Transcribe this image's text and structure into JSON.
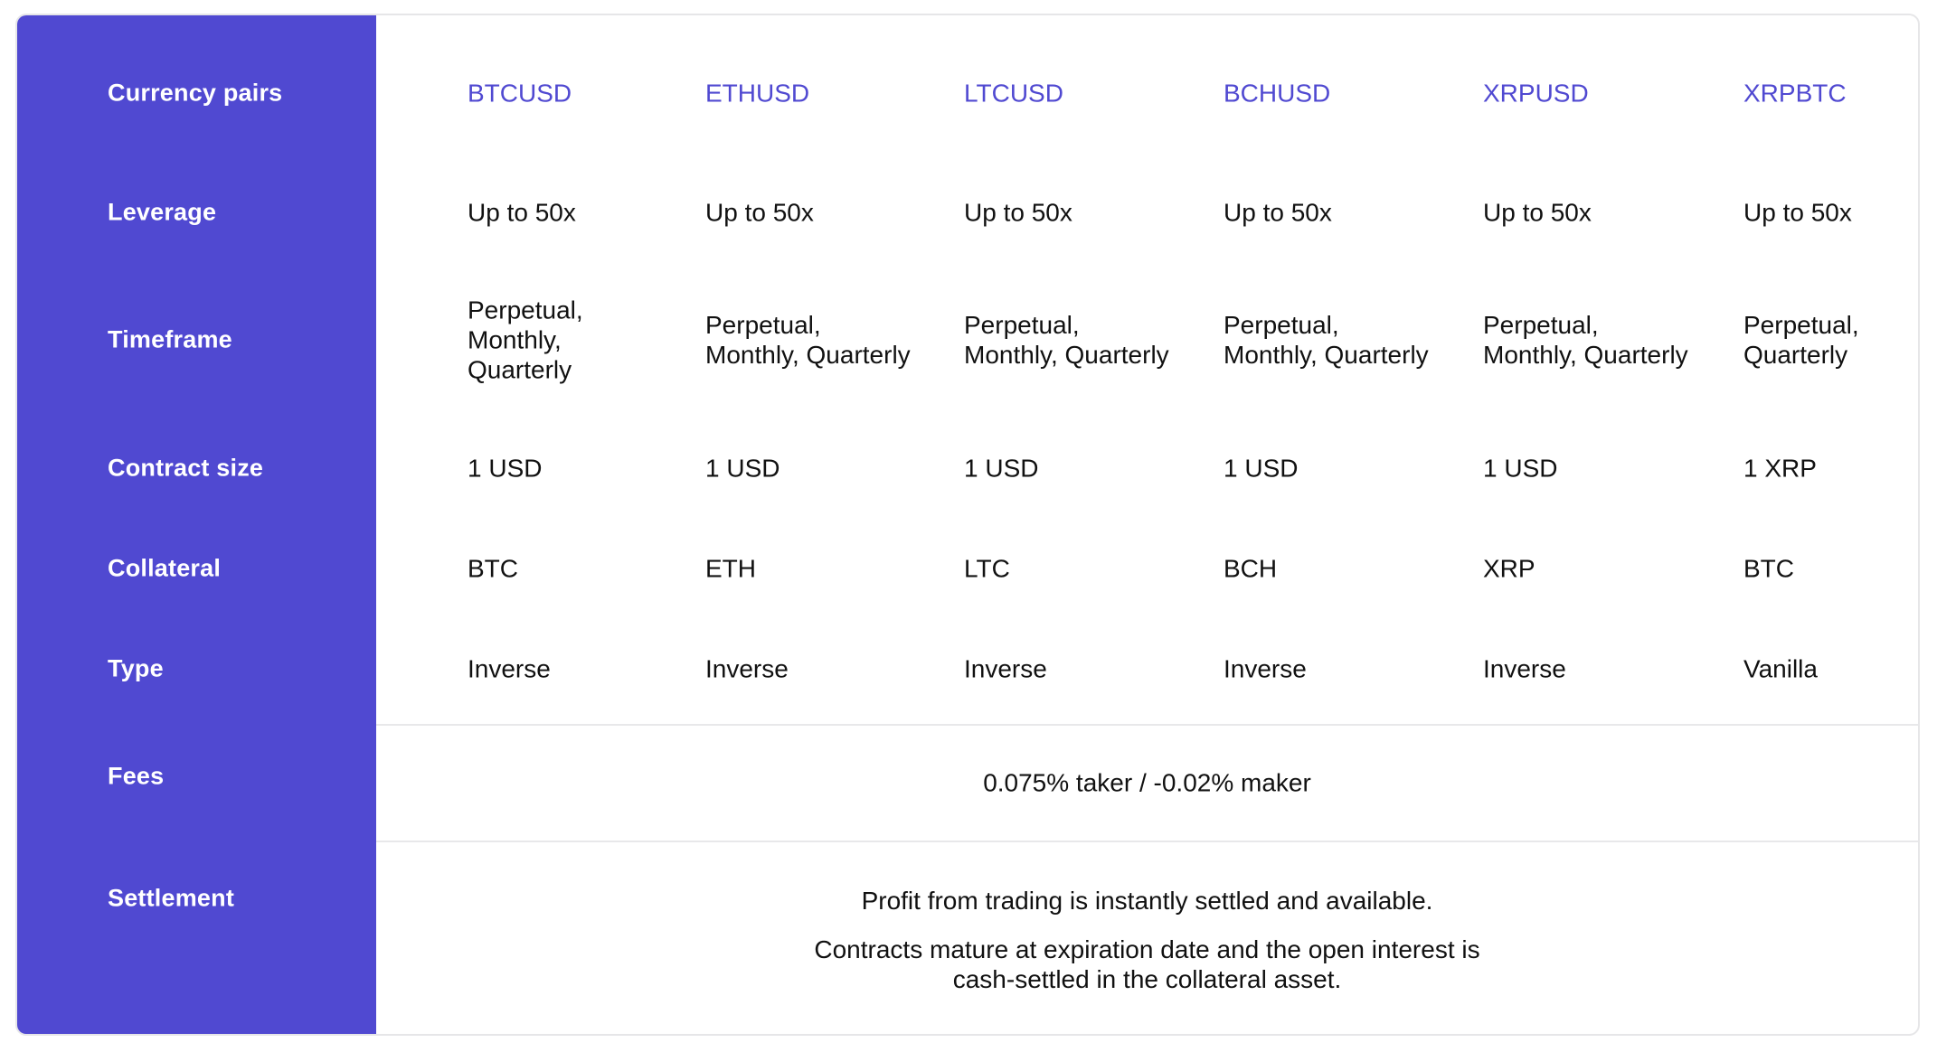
{
  "colors": {
    "accent": "#5049d1",
    "text": "#111111",
    "divider": "#e8e8ea"
  },
  "row_labels": {
    "currency_pairs": "Currency pairs",
    "leverage": "Leverage",
    "timeframe": "Timeframe",
    "contract_size": "Contract size",
    "collateral": "Collateral",
    "type": "Type",
    "fees": "Fees",
    "settlement": "Settlement"
  },
  "columns": [
    {
      "pair": "BTCUSD",
      "leverage": "Up to 50x",
      "timeframe": [
        "Perpetual,",
        "Monthly,",
        "Quarterly"
      ],
      "contract_size": "1 USD",
      "collateral": "BTC",
      "type": "Inverse"
    },
    {
      "pair": "ETHUSD",
      "leverage": "Up to 50x",
      "timeframe": [
        "Perpetual,",
        "Monthly, Quarterly"
      ],
      "contract_size": "1 USD",
      "collateral": "ETH",
      "type": "Inverse"
    },
    {
      "pair": "LTCUSD",
      "leverage": "Up to 50x",
      "timeframe": [
        "Perpetual,",
        "Monthly, Quarterly"
      ],
      "contract_size": "1 USD",
      "collateral": "LTC",
      "type": "Inverse"
    },
    {
      "pair": "BCHUSD",
      "leverage": "Up to 50x",
      "timeframe": [
        "Perpetual,",
        "Monthly, Quarterly"
      ],
      "contract_size": "1 USD",
      "collateral": "BCH",
      "type": "Inverse"
    },
    {
      "pair": "XRPUSD",
      "leverage": "Up to 50x",
      "timeframe": [
        "Perpetual,",
        "Monthly, Quarterly"
      ],
      "contract_size": "1 USD",
      "collateral": "XRP",
      "type": "Inverse"
    },
    {
      "pair": "XRPBTC",
      "leverage": "Up to 50x",
      "timeframe": [
        "Perpetual,",
        "Quarterly"
      ],
      "contract_size": "1 XRP",
      "collateral": "BTC",
      "type": "Vanilla"
    }
  ],
  "fees": "0.075% taker / -0.02% maker",
  "settlement": {
    "line1": "Profit from trading is instantly settled and available.",
    "line2": "Contracts mature at expiration date and the open interest is",
    "line3": "cash-settled in the collateral asset."
  }
}
